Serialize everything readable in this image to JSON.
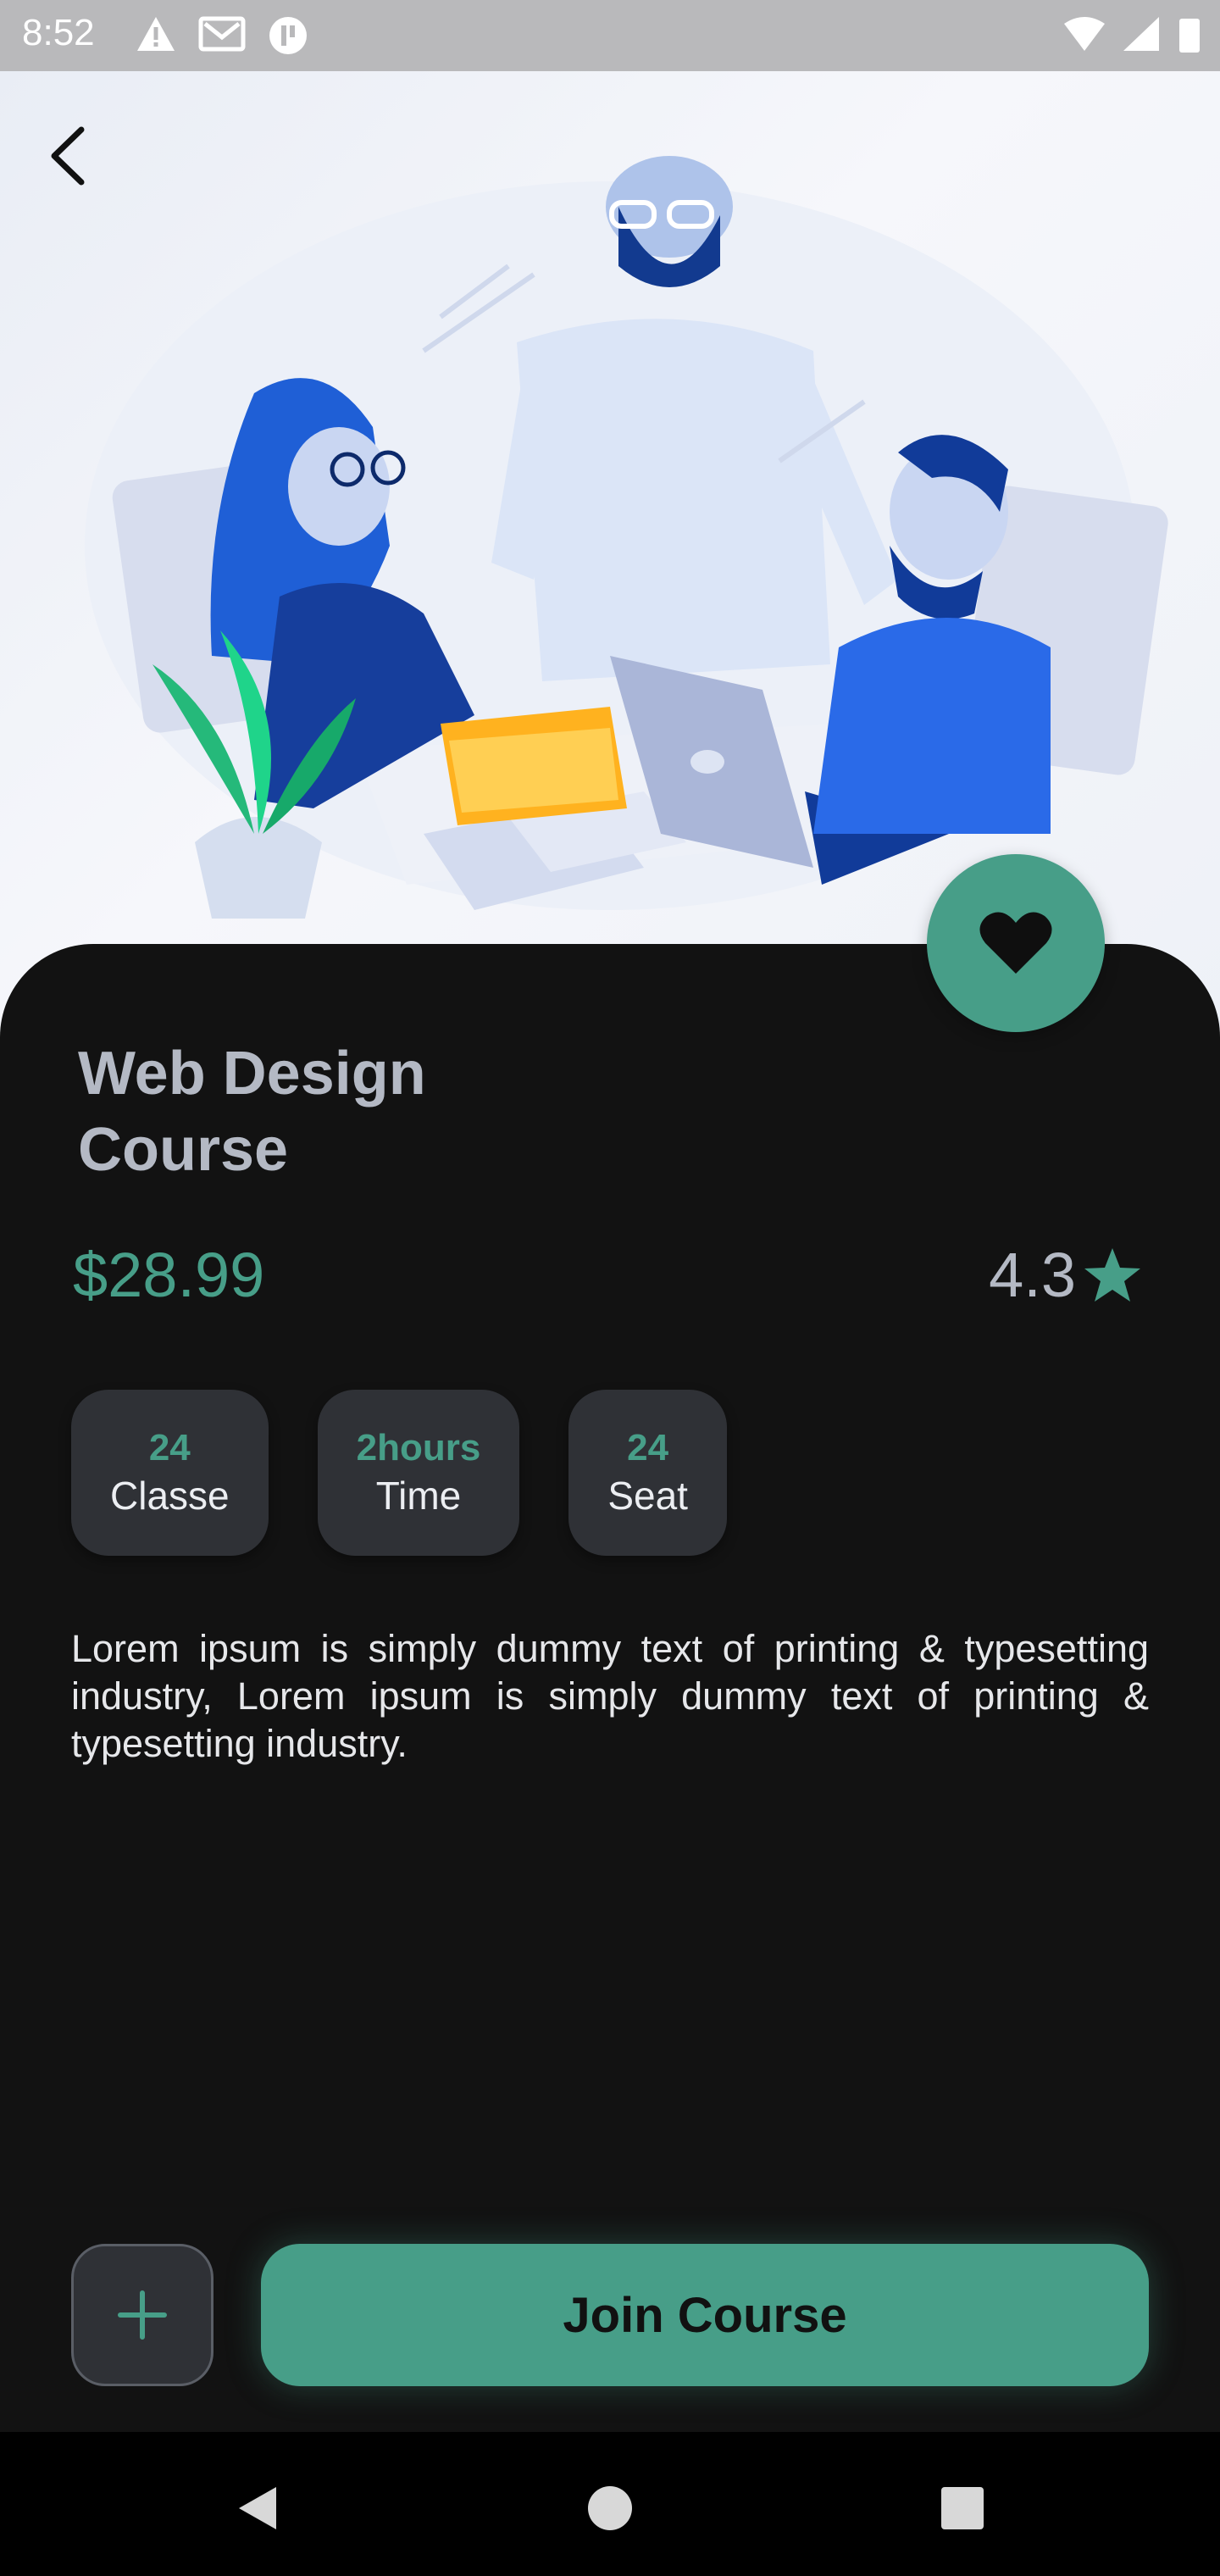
{
  "status_bar": {
    "time": "8:52"
  },
  "course": {
    "title": "Web Design Course",
    "price": "$28.99",
    "rating": "4.3",
    "stats": [
      {
        "value": "24",
        "label": "Classe"
      },
      {
        "value": "2hours",
        "label": "Time"
      },
      {
        "value": "24",
        "label": "Seat"
      }
    ],
    "description": "Lorem ipsum is simply dummy text of printing & typesetting industry, Lorem ipsum is simply dummy text of printing & typesetting industry."
  },
  "actions": {
    "join_label": "Join Course",
    "add_icon": "plus-icon",
    "favorite_icon": "heart-icon"
  },
  "colors": {
    "accent": "#479e88",
    "background": "#121212",
    "card": "#2f3136",
    "title": "#b4b9c4"
  }
}
